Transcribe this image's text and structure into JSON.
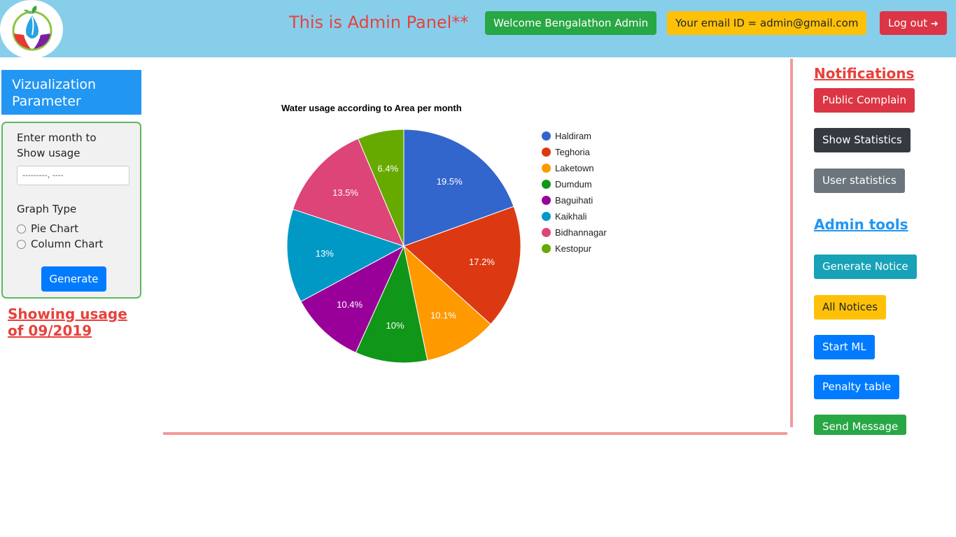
{
  "header": {
    "title": "This is Admin Panel**",
    "welcome_label": "Welcome Bengalathon Admin",
    "email_label": "Your email ID = admin@gmail.com",
    "logout_label": "Log out"
  },
  "sidebar": {
    "heading": "Vizualization Parameter",
    "month_label": "Enter month to Show usage",
    "month_placeholder": "---------, ----",
    "graph_type_label": "Graph Type",
    "options": [
      "Pie Chart",
      "Column Chart"
    ],
    "generate_label": "Generate",
    "showing_label": "Showing usage of 09/2019"
  },
  "chart_data": {
    "type": "pie",
    "title": "Water usage according to Area per month",
    "legend_position": "right",
    "slices": [
      {
        "label": "Haldiram",
        "value": 19.5,
        "display": "19.5%",
        "color": "#3366cc"
      },
      {
        "label": "Teghoria",
        "value": 17.2,
        "display": "17.2%",
        "color": "#dc3912"
      },
      {
        "label": "Laketown",
        "value": 10.1,
        "display": "10.1%",
        "color": "#ff9900"
      },
      {
        "label": "Dumdum",
        "value": 10,
        "display": "10%",
        "color": "#109618"
      },
      {
        "label": "Baguihati",
        "value": 10.4,
        "display": "10.4%",
        "color": "#990099"
      },
      {
        "label": "Kaikhali",
        "value": 13,
        "display": "13%",
        "color": "#0099c6"
      },
      {
        "label": "Bidhannagar",
        "value": 13.5,
        "display": "13.5%",
        "color": "#dd4477"
      },
      {
        "label": "Kestopur",
        "value": 6.4,
        "display": "6.4%",
        "color": "#66aa00"
      }
    ]
  },
  "right_panel": {
    "notifications_heading": "Notifications",
    "public_complain": "Public Complain",
    "show_statistics": "Show Statistics",
    "user_statistics": "User statistics",
    "admin_tools_heading": "Admin tools",
    "generate_notice": "Generate Notice",
    "all_notices": "All Notices",
    "start_ml": "Start ML",
    "penalty_table": "Penalty table",
    "send_message": "Send Message"
  },
  "colors": {
    "header_bg": "#87ceeb",
    "accent_red": "#e8413c",
    "primary_blue": "#007bff",
    "divider_pink": "#f4999b"
  }
}
